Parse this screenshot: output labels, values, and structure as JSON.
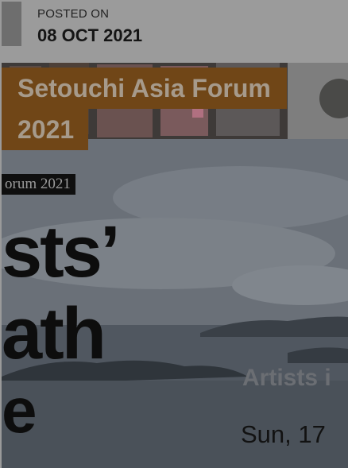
{
  "post": {
    "posted_label": "POSTED ON",
    "posted_date": "08 OCT 2021",
    "title_line1": "Setouchi Asia Forum",
    "title_line2": "2021"
  },
  "poster": {
    "forum_tag": "orum 2021",
    "word1": "sts’",
    "word2": "ath",
    "word3": "e",
    "artists_text": "Artists i",
    "date_text": "Sun, 17"
  },
  "colors": {
    "title_bg": "#704617",
    "title_text": "#a69a8b",
    "overlay": "#9a9a9a"
  }
}
